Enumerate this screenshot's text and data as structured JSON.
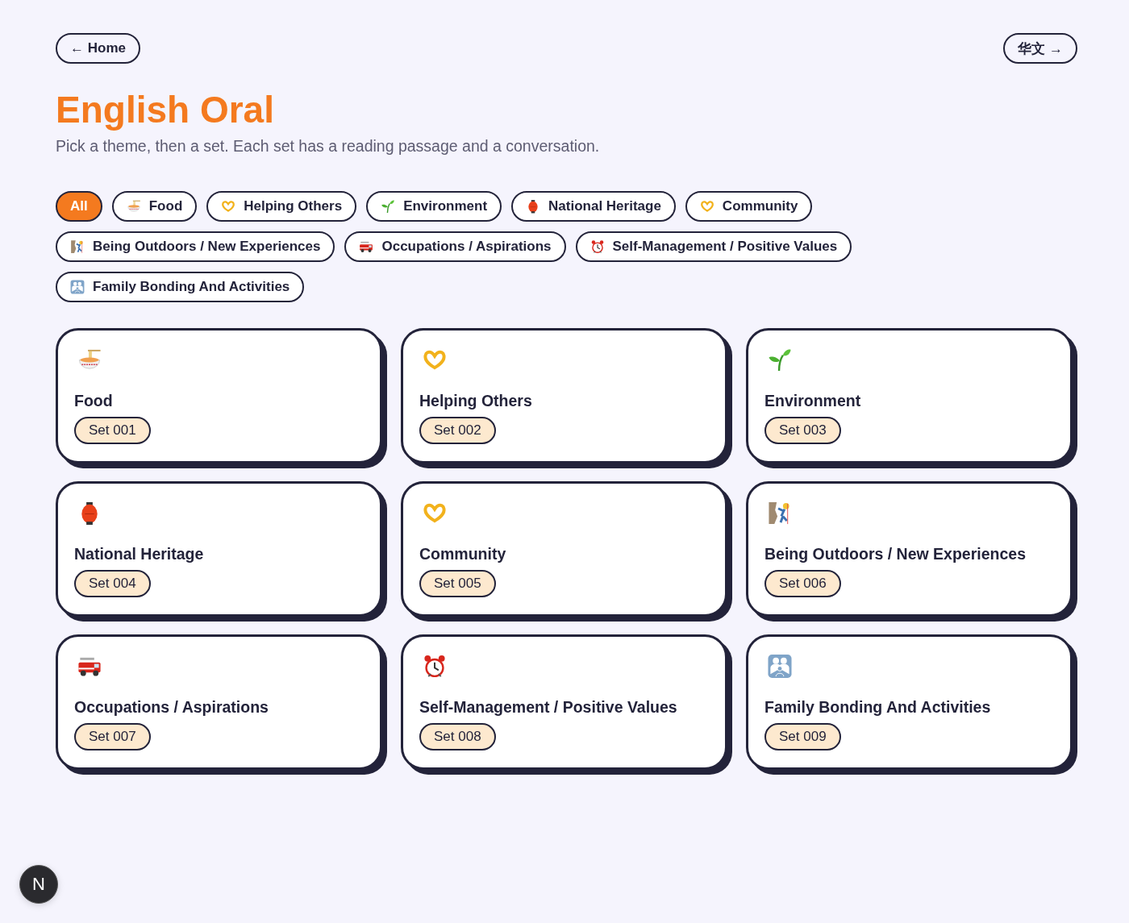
{
  "nav": {
    "home": "← Home",
    "language": "华文 →"
  },
  "header": {
    "title": "English Oral",
    "subtitle": "Pick a theme, then a set. Each set has a reading passage and a conversation."
  },
  "filters": [
    {
      "label": "All",
      "selected": true
    },
    {
      "label": "Food",
      "selected": false
    },
    {
      "label": "Helping Others",
      "selected": false
    },
    {
      "label": "Environment",
      "selected": false
    },
    {
      "label": "National Heritage",
      "selected": false
    },
    {
      "label": "Community",
      "selected": false
    },
    {
      "label": "Being Outdoors / New Experiences",
      "selected": false
    },
    {
      "label": "Occupations / Aspirations",
      "selected": false
    },
    {
      "label": "Self-Management / Positive Values",
      "selected": false
    },
    {
      "label": "Family Bonding And Activities",
      "selected": false
    }
  ],
  "themes": [
    {
      "title": "Food",
      "sets": [
        "Set 001"
      ]
    },
    {
      "title": "Helping Others",
      "sets": [
        "Set 002"
      ]
    },
    {
      "title": "Environment",
      "sets": [
        "Set 003"
      ]
    },
    {
      "title": "National Heritage",
      "sets": [
        "Set 004"
      ]
    },
    {
      "title": "Community",
      "sets": [
        "Set 005"
      ]
    },
    {
      "title": "Being Outdoors / New Experiences",
      "sets": [
        "Set 006"
      ]
    },
    {
      "title": "Occupations / Aspirations",
      "sets": [
        "Set 007"
      ]
    },
    {
      "title": "Self-Management / Positive Values",
      "sets": [
        "Set 008"
      ]
    },
    {
      "title": "Family Bonding And Activities",
      "sets": [
        "Set 009"
      ]
    }
  ],
  "dev_badge": "N"
}
